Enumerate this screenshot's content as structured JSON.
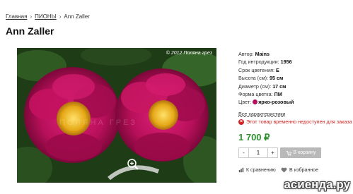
{
  "breadcrumb": {
    "items": [
      "Главная",
      "ПИОНЫ",
      "Ann Zaller"
    ],
    "separator": "›"
  },
  "product": {
    "title": "Ann Zaller",
    "photo": {
      "copyright": "© 2012 Поляна грез",
      "watermark": "ПОЛЯНА ГРЕЗ"
    },
    "properties": [
      {
        "label": "Автор:",
        "value": "Mains"
      },
      {
        "label": "Год интродукции:",
        "value": "1956"
      },
      {
        "label": "Срок цветения:",
        "value": "E"
      },
      {
        "label": "Высота (см):",
        "value": "95 см"
      },
      {
        "label": "Диаметр (см):",
        "value": "17 см"
      },
      {
        "label": "Форма цветка:",
        "value": "ПМ"
      },
      {
        "label": "Цвет:",
        "value": "ярко-розовый"
      }
    ],
    "color_swatch": "#b5115f",
    "all_characteristics_link": "Все характеристики",
    "availability_text": "Этот товар временно недоступен для заказа",
    "price": "1 700 ₽",
    "quantity": "1",
    "qty_minus": "-",
    "qty_plus": "+",
    "add_to_cart": "В корзину",
    "compare": "К сравнению",
    "favorites": "В избранное"
  },
  "site_logo": "асиенда.ру",
  "colors": {
    "price_green": "#2c8f2c",
    "error_red": "#d32222",
    "button_gray": "#b9b9b9"
  },
  "icons": [
    "zoom-icon",
    "error-icon",
    "cart-icon",
    "compare-icon",
    "heart-icon"
  ]
}
